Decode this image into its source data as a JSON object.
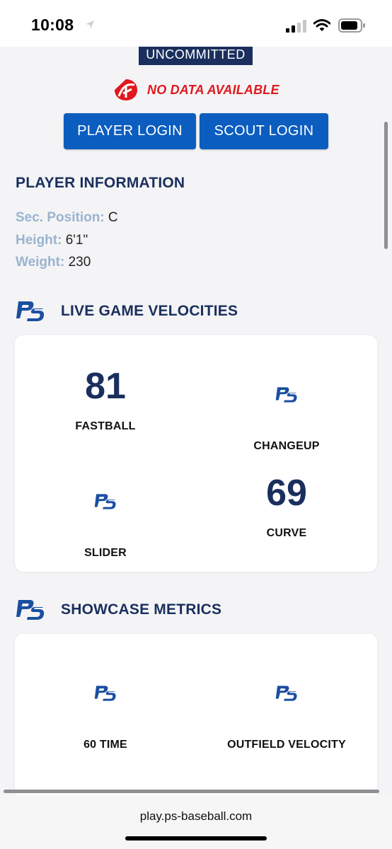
{
  "status_bar": {
    "time": "10:08"
  },
  "header": {
    "commit_status": "UNCOMMITTED",
    "no_data_text": "NO DATA AVAILABLE",
    "player_login_label": "PLAYER LOGIN",
    "scout_login_label": "SCOUT LOGIN"
  },
  "player_info": {
    "title": "PLAYER INFORMATION",
    "fields": [
      {
        "label": "Sec. Position:",
        "value": "C"
      },
      {
        "label": "Height:",
        "value": "6'1\""
      },
      {
        "label": "Weight:",
        "value": "230"
      }
    ]
  },
  "live_velocities": {
    "title": "LIVE GAME VELOCITIES",
    "items": [
      {
        "label": "FASTBALL",
        "value": "81"
      },
      {
        "label": "CHANGEUP",
        "value": ""
      },
      {
        "label": "SLIDER",
        "value": ""
      },
      {
        "label": "CURVE",
        "value": "69"
      }
    ]
  },
  "showcase": {
    "title": "SHOWCASE METRICS",
    "items": [
      {
        "label": "60 TIME",
        "value": ""
      },
      {
        "label": "OUTFIELD VELOCITY",
        "value": ""
      }
    ]
  },
  "browser": {
    "url": "play.ps-baseball.com"
  },
  "colors": {
    "navy": "#1a2f5e",
    "button_blue": "#0b5dbf",
    "alert_red": "#e0181f",
    "label_blue": "#9ab3cf"
  },
  "icons": [
    "location-arrow-icon",
    "signal-icon",
    "wifi-icon",
    "battery-icon",
    "ps-logo-icon",
    "no-data-logo-icon"
  ]
}
